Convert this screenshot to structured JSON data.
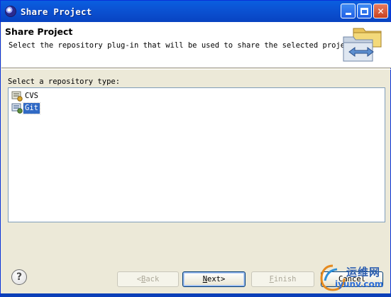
{
  "window": {
    "title": "Share Project",
    "title_icon": "eclipse-icon",
    "controls": [
      "minimize-icon",
      "maximize-icon",
      "close-icon"
    ],
    "close_glyph": "✕"
  },
  "banner": {
    "title": "Share Project",
    "description": "Select the repository plug-in that will be used to share the selected project.",
    "graphic": "share-folders-icon"
  },
  "repository": {
    "label": "Select a repository type:",
    "items": [
      {
        "label": "CVS",
        "icon": "cvs-repository-icon",
        "selected": false
      },
      {
        "label": "Git",
        "icon": "git-repository-icon",
        "selected": true
      }
    ]
  },
  "buttons": {
    "help_glyph": "?",
    "back": {
      "mnemonic": "B",
      "rest": "ack",
      "prefix": "< ",
      "enabled": false
    },
    "next": {
      "mnemonic": "N",
      "rest": "ext",
      "suffix": " >",
      "enabled": true
    },
    "finish": {
      "mnemonic": "F",
      "rest": "inish",
      "enabled": false
    },
    "cancel": {
      "label": "Cancel",
      "enabled": true
    }
  },
  "watermark": {
    "cn_text": "运维网",
    "url": "iyunv.com"
  },
  "colors": {
    "titlebar": "#0b53d4",
    "selection": "#316ac5",
    "dialog": "#ece9d8"
  }
}
